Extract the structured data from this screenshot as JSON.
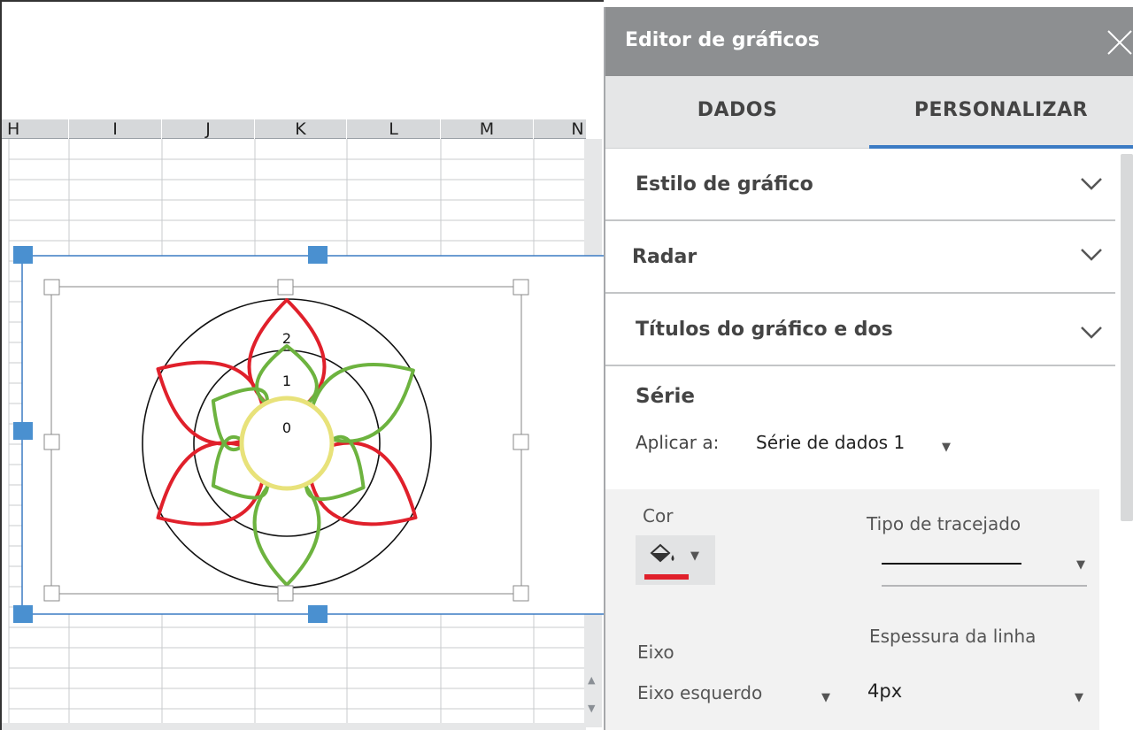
{
  "sheet": {
    "columns": [
      "H",
      "I",
      "J",
      "K",
      "L",
      "M",
      "N"
    ]
  },
  "chart": {
    "type": "radar",
    "axis_labels": [
      "0",
      "1",
      "2"
    ],
    "series": [
      {
        "color": "#e0202b"
      },
      {
        "color": "#6db33f"
      }
    ],
    "center_circle_color": "#e8e27a"
  },
  "editor": {
    "title": "Editor de gráficos",
    "tabs": [
      {
        "label": "DADOS"
      },
      {
        "label": "PERSONALIZAR",
        "active": true
      }
    ],
    "sections": [
      {
        "label": "Estilo de gráfico"
      },
      {
        "label": "Radar"
      },
      {
        "label": "Títulos do gráfico e dos"
      }
    ],
    "serie": {
      "title": "Série",
      "apply_label": "Aplicar a:",
      "apply_value": "Série de dados 1",
      "cor_label": "Cor",
      "cor_value": "#e0202b",
      "dash_label": "Tipo de tracejado",
      "eixo_label": "Eixo",
      "eixo_value": "Eixo esquerdo",
      "espessura_label": "Espessura da linha",
      "espessura_value": "4px"
    },
    "accent_color": "#3b7bc4"
  }
}
